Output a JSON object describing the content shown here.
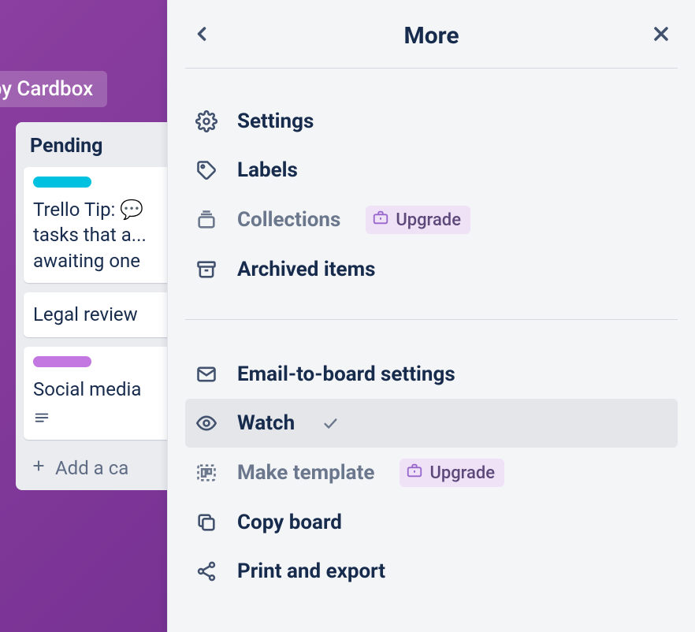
{
  "top_button": {
    "label": "il by Cardbox"
  },
  "list": {
    "title": "Pending",
    "cards": [
      {
        "label_color": "teal",
        "text": "Trello Tip: 💬 tasks that a... awaiting one"
      },
      {
        "label_color": null,
        "text": "Legal review"
      },
      {
        "label_color": "purple",
        "text": "Social media",
        "has_description": true
      }
    ],
    "add_card_label": "Add a ca"
  },
  "panel": {
    "title": "More",
    "sections": [
      [
        {
          "id": "settings",
          "label": "Settings"
        },
        {
          "id": "labels",
          "label": "Labels"
        },
        {
          "id": "collections",
          "label": "Collections",
          "disabled": true,
          "upgrade": true
        },
        {
          "id": "archived",
          "label": "Archived items"
        }
      ],
      [
        {
          "id": "email",
          "label": "Email-to-board settings"
        },
        {
          "id": "watch",
          "label": "Watch",
          "checked": true,
          "highlight": true
        },
        {
          "id": "template",
          "label": "Make template",
          "disabled": true,
          "upgrade": true
        },
        {
          "id": "copy",
          "label": "Copy board"
        },
        {
          "id": "print",
          "label": "Print and export"
        }
      ]
    ],
    "upgrade_label": "Upgrade"
  }
}
